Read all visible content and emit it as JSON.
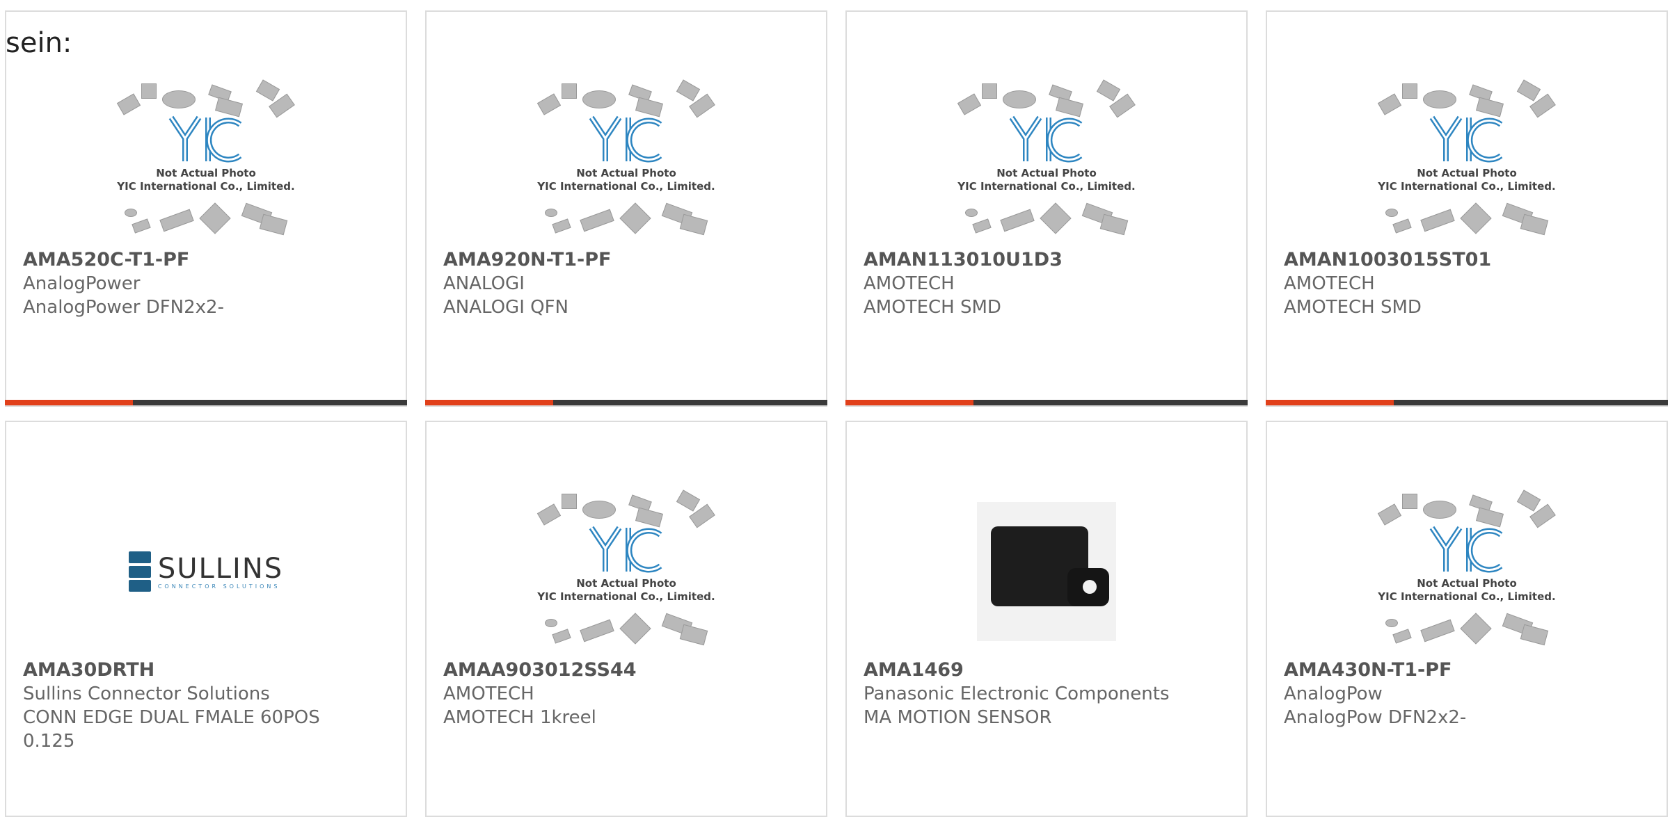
{
  "heading": "sein:",
  "placeholder": {
    "line1": "Not Actual Photo",
    "line2": "YIC International Co., Limited."
  },
  "sullins_logo": {
    "name": "SULLINS",
    "sub": "CONNECTOR SOLUTIONS"
  },
  "products": [
    {
      "part": "AMA520C-T1-PF",
      "manufacturer": "AnalogPower",
      "desc": "AnalogPower DFN2x2-",
      "image": "placeholder"
    },
    {
      "part": "AMA920N-T1-PF",
      "manufacturer": "ANALOGI",
      "desc": "ANALOGI QFN",
      "image": "placeholder"
    },
    {
      "part": "AMAN113010U1D3",
      "manufacturer": "AMOTECH",
      "desc": "AMOTECH SMD",
      "image": "placeholder"
    },
    {
      "part": "AMAN1003015ST01",
      "manufacturer": "AMOTECH",
      "desc": "AMOTECH SMD",
      "image": "placeholder"
    },
    {
      "part": "AMA30DRTH",
      "manufacturer": "Sullins Connector Solutions",
      "desc": "CONN EDGE DUAL FMALE 60POS",
      "desc2": "0.125",
      "image": "sullins-logo"
    },
    {
      "part": "AMAA903012SS44",
      "manufacturer": "AMOTECH",
      "desc": "AMOTECH 1kreel",
      "image": "placeholder"
    },
    {
      "part": "AMA1469",
      "manufacturer": "Panasonic Electronic Components",
      "desc": "MA MOTION SENSOR",
      "image": "sensor-photo"
    },
    {
      "part": "AMA430N-T1-PF",
      "manufacturer": "AnalogPow",
      "desc": "AnalogPow DFN2x2-",
      "image": "placeholder"
    }
  ],
  "colors": {
    "accent": "#e1401a",
    "bar": "#3a3a3a",
    "border": "#dcdcdc",
    "logo_blue": "#1f5f86"
  }
}
